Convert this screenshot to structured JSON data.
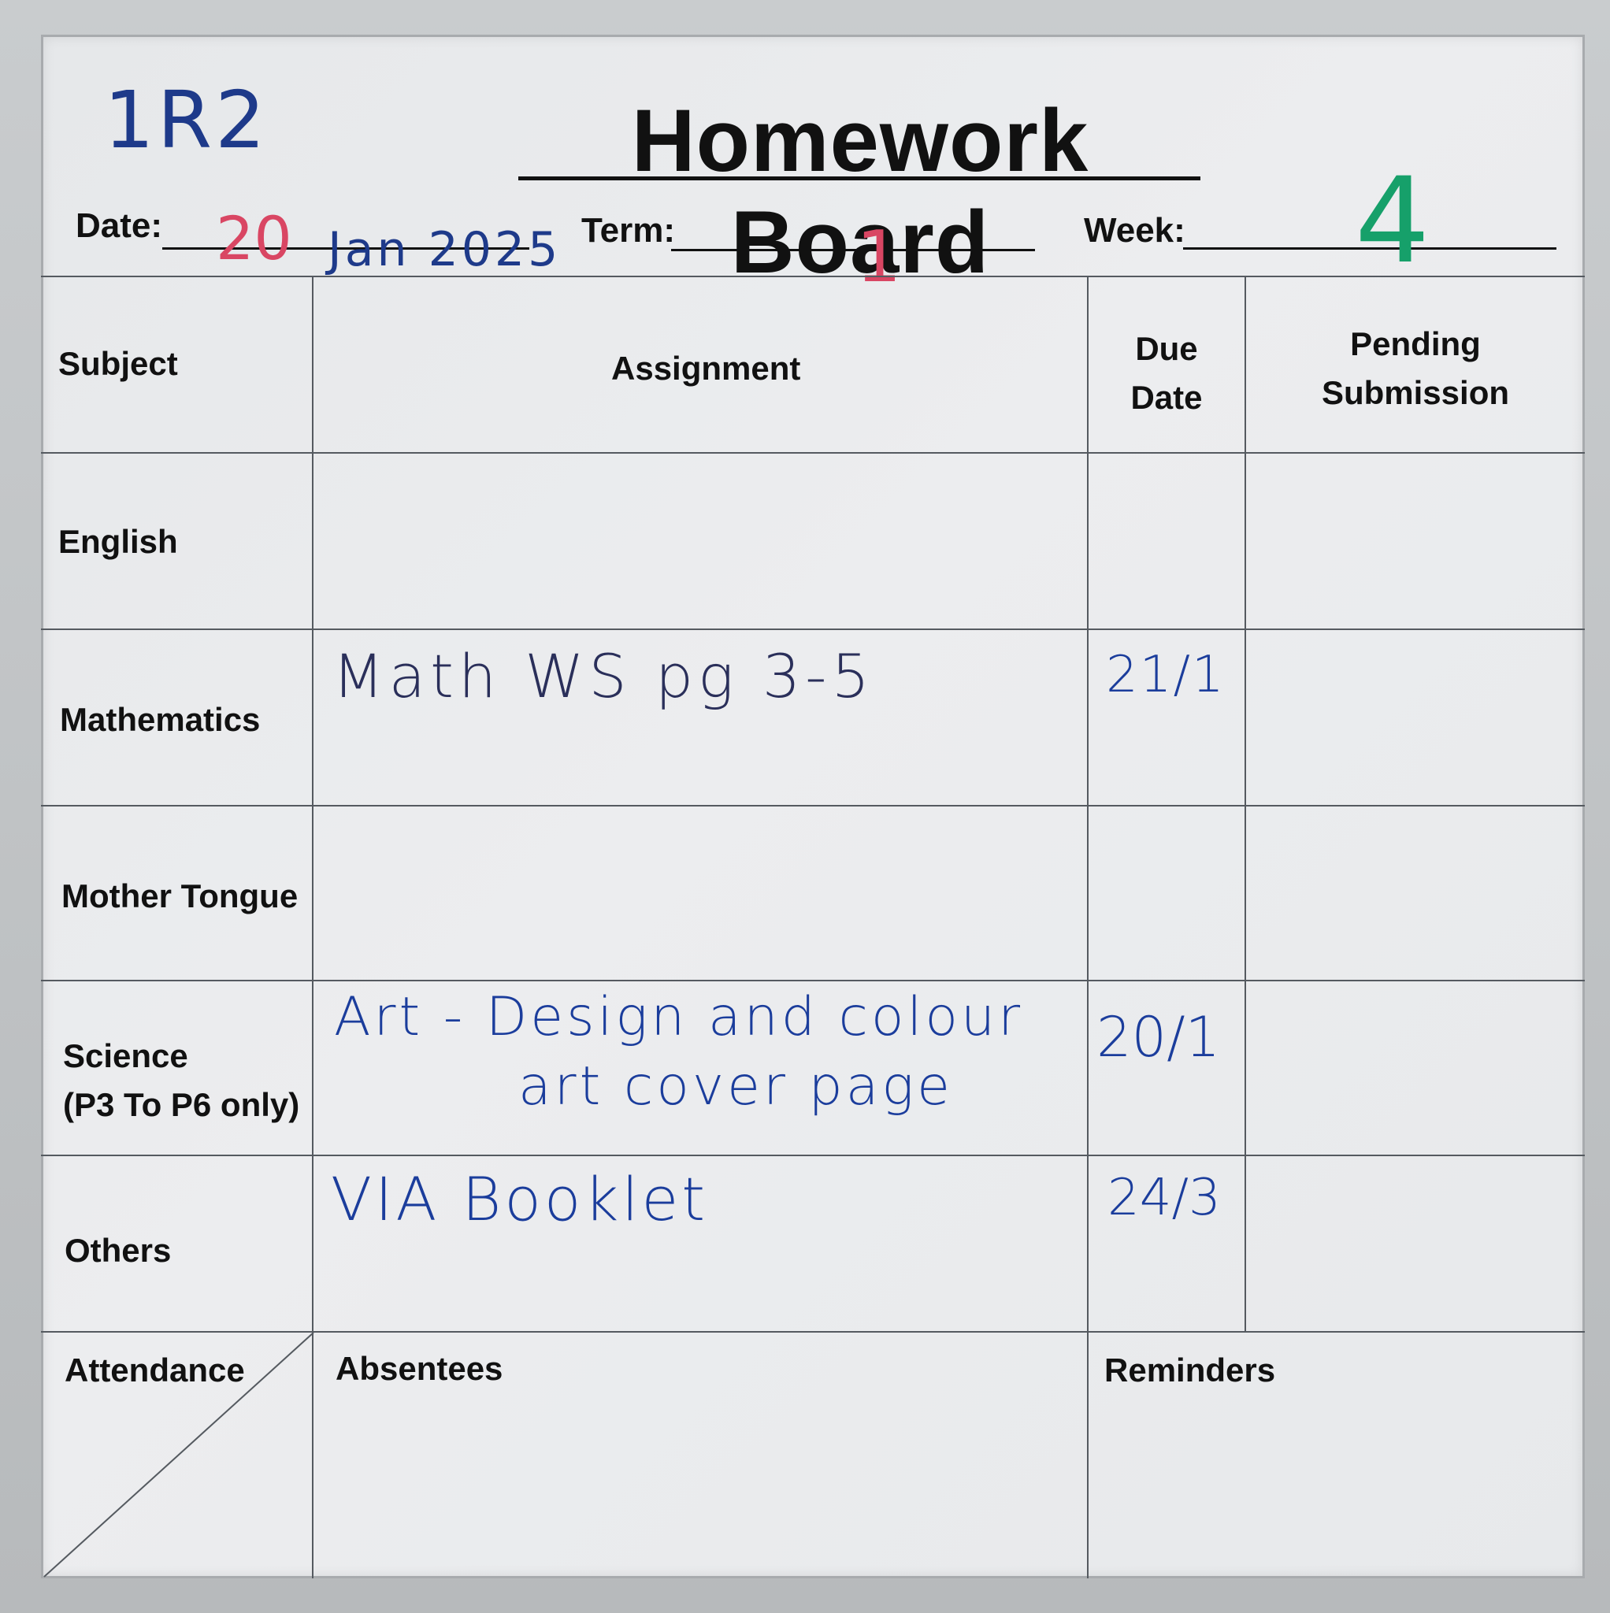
{
  "board": {
    "class_code": "1R2",
    "title": "Homework Board",
    "date_label": "Date:",
    "date_day": "20",
    "date_rest": "Jan 2025",
    "term_label": "Term:",
    "term_value": "1",
    "week_label": "Week:",
    "week_value": "4"
  },
  "table": {
    "headers": {
      "subject": "Subject",
      "assignment": "Assignment",
      "due_date_line1": "Due",
      "due_date_line2": "Date",
      "pending_line1": "Pending",
      "pending_line2": "Submission"
    },
    "rows": [
      {
        "subject": "English",
        "assignment": "",
        "due": ""
      },
      {
        "subject": "Mathematics",
        "assignment": "Math WS pg 3-5",
        "due": "21/1"
      },
      {
        "subject": "Mother Tongue",
        "assignment": "",
        "due": ""
      },
      {
        "subject_line1": "Science",
        "subject_line2": "(P3 To P6 only)",
        "assignment_line1": "Art - Design and colour",
        "assignment_line2": "art cover page",
        "due": "20/1"
      },
      {
        "subject": "Others",
        "assignment": "VIA Booklet",
        "due": "24/3"
      }
    ],
    "footer": {
      "attendance": "Attendance",
      "absentees": "Absentees",
      "reminders": "Reminders"
    }
  },
  "colors": {
    "marker_blue": "#1e3a8a",
    "marker_red": "#d94663",
    "marker_green": "#16a06a",
    "print_black": "#111111"
  }
}
